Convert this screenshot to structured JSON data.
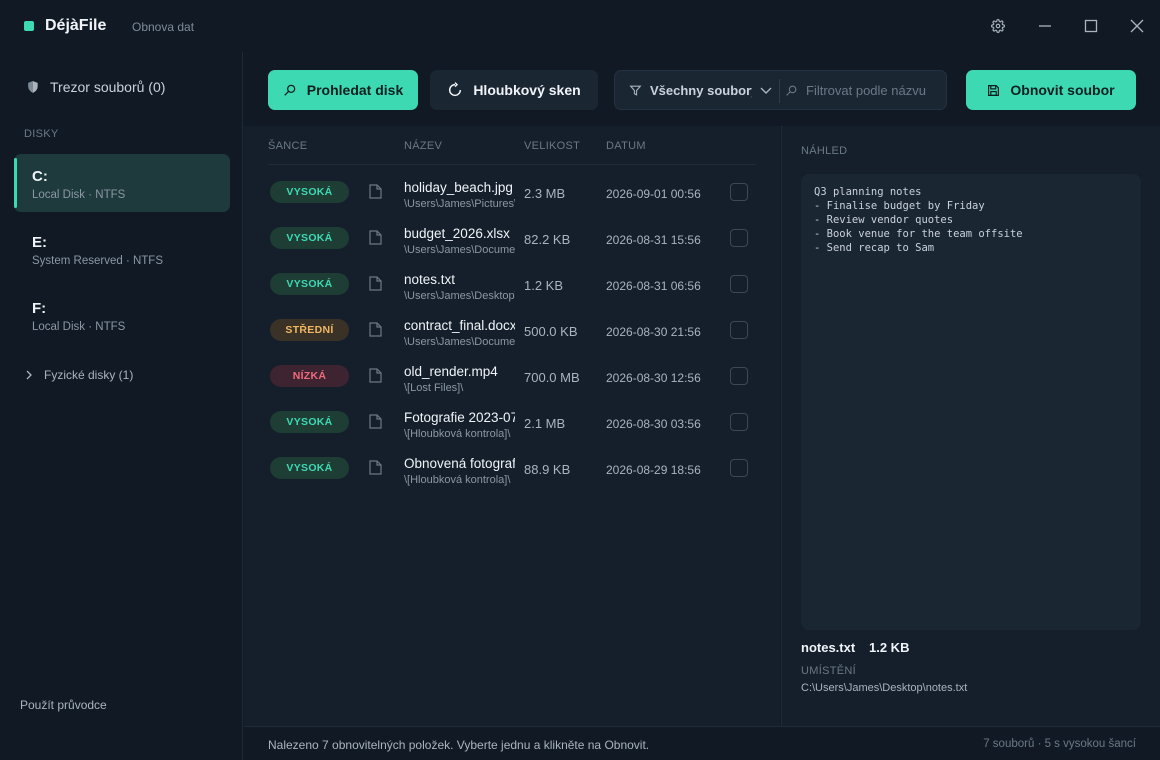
{
  "app": {
    "name": "DéjàFile",
    "subtitle": "Obnova dat"
  },
  "sidebar": {
    "vault_label": "Trezor souborů (0)",
    "section_label": "DISKY",
    "drives": [
      {
        "letter": "C:",
        "label": "Local Disk",
        "fs": "NTFS",
        "desc": "Local Disk · NTFS",
        "active": true
      },
      {
        "letter": "E:",
        "label": "System Reserved",
        "fs": "NTFS",
        "desc": "System Reserved · NTFS",
        "active": false
      },
      {
        "letter": "F:",
        "label": "Local Disk",
        "fs": "NTFS",
        "desc": "Local Disk · NTFS",
        "active": false
      }
    ],
    "physical_label": "Fyzické disky (1)",
    "guide_label": "Použít průvodce"
  },
  "toolbar": {
    "scan_label": "Prohledat disk",
    "deep_scan_label": "Hloubkový sken",
    "filter_select_value": "Všechny soubory",
    "filter_placeholder": "Filtrovat podle názvu",
    "recover_label": "Obnovit soubor"
  },
  "table": {
    "columns": {
      "chance": "ŠANCE",
      "name": "NÁZEV",
      "size": "VELIKOST",
      "date": "DATUM"
    },
    "rows": [
      {
        "chance": "VYSOKÁ",
        "level": "high",
        "name": "holiday_beach.jpg",
        "path": "\\Users\\James\\Pictures\\",
        "size": "2.3 MB",
        "date": "2026-09-01 00:56",
        "checked": false
      },
      {
        "chance": "VYSOKÁ",
        "level": "high",
        "name": "budget_2026.xlsx",
        "path": "\\Users\\James\\Documents\\",
        "size": "82.2 KB",
        "date": "2026-08-31 15:56",
        "checked": false
      },
      {
        "chance": "VYSOKÁ",
        "level": "high",
        "name": "notes.txt",
        "path": "\\Users\\James\\Desktop\\",
        "size": "1.2 KB",
        "date": "2026-08-31 06:56",
        "checked": false
      },
      {
        "chance": "STŘEDNÍ",
        "level": "mid",
        "name": "contract_final.docx",
        "path": "\\Users\\James\\Documents\\",
        "size": "500.0 KB",
        "date": "2026-08-30 21:56",
        "checked": false
      },
      {
        "chance": "NÍZKÁ",
        "level": "low",
        "name": "old_render.mp4",
        "path": "\\[Lost Files]\\",
        "size": "700.0 MB",
        "date": "2026-08-30 12:56",
        "checked": false
      },
      {
        "chance": "VYSOKÁ",
        "level": "high",
        "name": "Fotografie 2023-07",
        "path": "\\[Hloubková kontrola]\\",
        "size": "2.1 MB",
        "date": "2026-08-30 03:56",
        "checked": false
      },
      {
        "chance": "VYSOKÁ",
        "level": "high",
        "name": "Obnovená fotografie",
        "path": "\\[Hloubková kontrola]\\",
        "size": "88.9 KB",
        "date": "2026-08-29 18:56",
        "checked": false
      }
    ]
  },
  "preview": {
    "header": "NÁHLED",
    "lines": [
      "Q3 planning notes",
      "- Finalise budget by Friday",
      "- Review vendor quotes",
      "- Book venue for the team offsite",
      "- Send recap to Sam"
    ],
    "file_name": "notes.txt",
    "file_size": "1.2 KB",
    "location_label": "UMÍSTĚNÍ",
    "location_value": "C:\\Users\\James\\Desktop\\notes.txt"
  },
  "status": {
    "message": "Nalezeno 7 obnovitelných položek. Vyberte jednu a klikněte na Obnovit.",
    "count": "7 souborů",
    "high_count": "5 s vysokou šancí",
    "summary": "7 souborů · 5 s vysokou šancí"
  },
  "colors": {
    "accent": "#3dd9b3",
    "background": "#111a24",
    "panel": "#141f2b",
    "high": "#3dd9b3",
    "mid": "#f0b860",
    "low": "#f06a7d"
  },
  "icons": {
    "vault": "shield-icon",
    "scan": "search-icon",
    "deep_scan": "refresh-icon",
    "filter": "funnel-icon",
    "recover": "save-icon",
    "file": "file-icon",
    "settings": "gear-icon"
  }
}
